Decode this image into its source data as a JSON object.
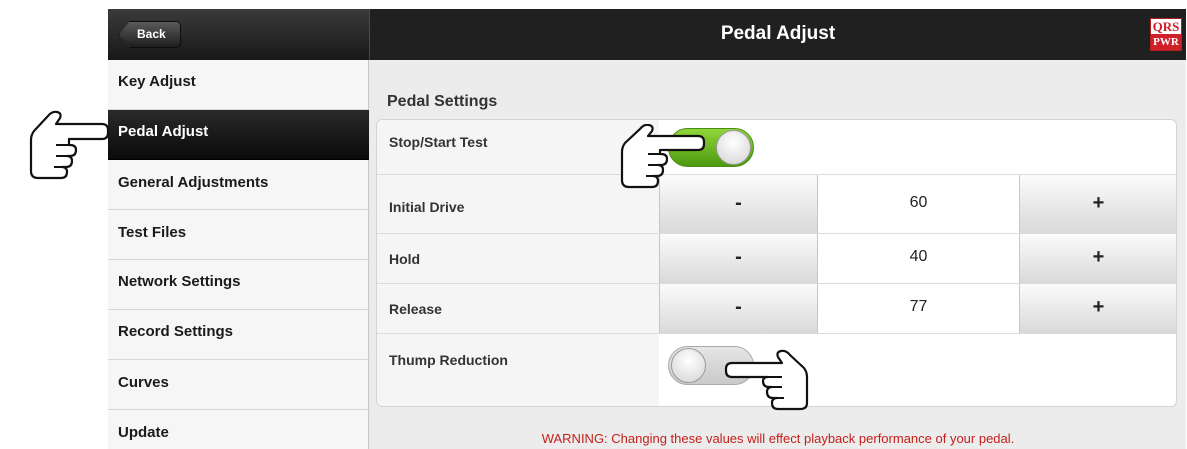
{
  "header": {
    "back_label": "Back",
    "title": "Pedal Adjust",
    "logo_top": "QRS",
    "logo_bottom": "PWR"
  },
  "sidebar": {
    "items": [
      {
        "label": "Key Adjust",
        "active": false
      },
      {
        "label": "Pedal Adjust",
        "active": true
      },
      {
        "label": "General Adjustments",
        "active": false
      },
      {
        "label": "Test Files",
        "active": false
      },
      {
        "label": "Network Settings",
        "active": false
      },
      {
        "label": "Record Settings",
        "active": false
      },
      {
        "label": "Curves",
        "active": false
      },
      {
        "label": "Update",
        "active": false
      }
    ]
  },
  "main": {
    "section_title": "Pedal Settings",
    "stop_start": {
      "label": "Stop/Start Test",
      "state": "on"
    },
    "initial_drive": {
      "label": "Initial Drive",
      "minus": "-",
      "value": "60",
      "plus": "+"
    },
    "hold": {
      "label": "Hold",
      "minus": "-",
      "value": "40",
      "plus": "+"
    },
    "release": {
      "label": "Release",
      "minus": "-",
      "value": "77",
      "plus": "+"
    },
    "thump_reduction": {
      "label": "Thump Reduction",
      "state": "off"
    },
    "warning": "WARNING: Changing these values will effect playback performance of your pedal."
  },
  "colors": {
    "toggle_on": "#6cbf22",
    "warning_text": "#c4201c",
    "header_bg": "#202020",
    "active_item_bg": "#111111"
  },
  "annotations": {
    "pointer_icons": [
      "pointing-hand-icon",
      "pointing-hand-icon",
      "pointing-hand-icon"
    ]
  }
}
